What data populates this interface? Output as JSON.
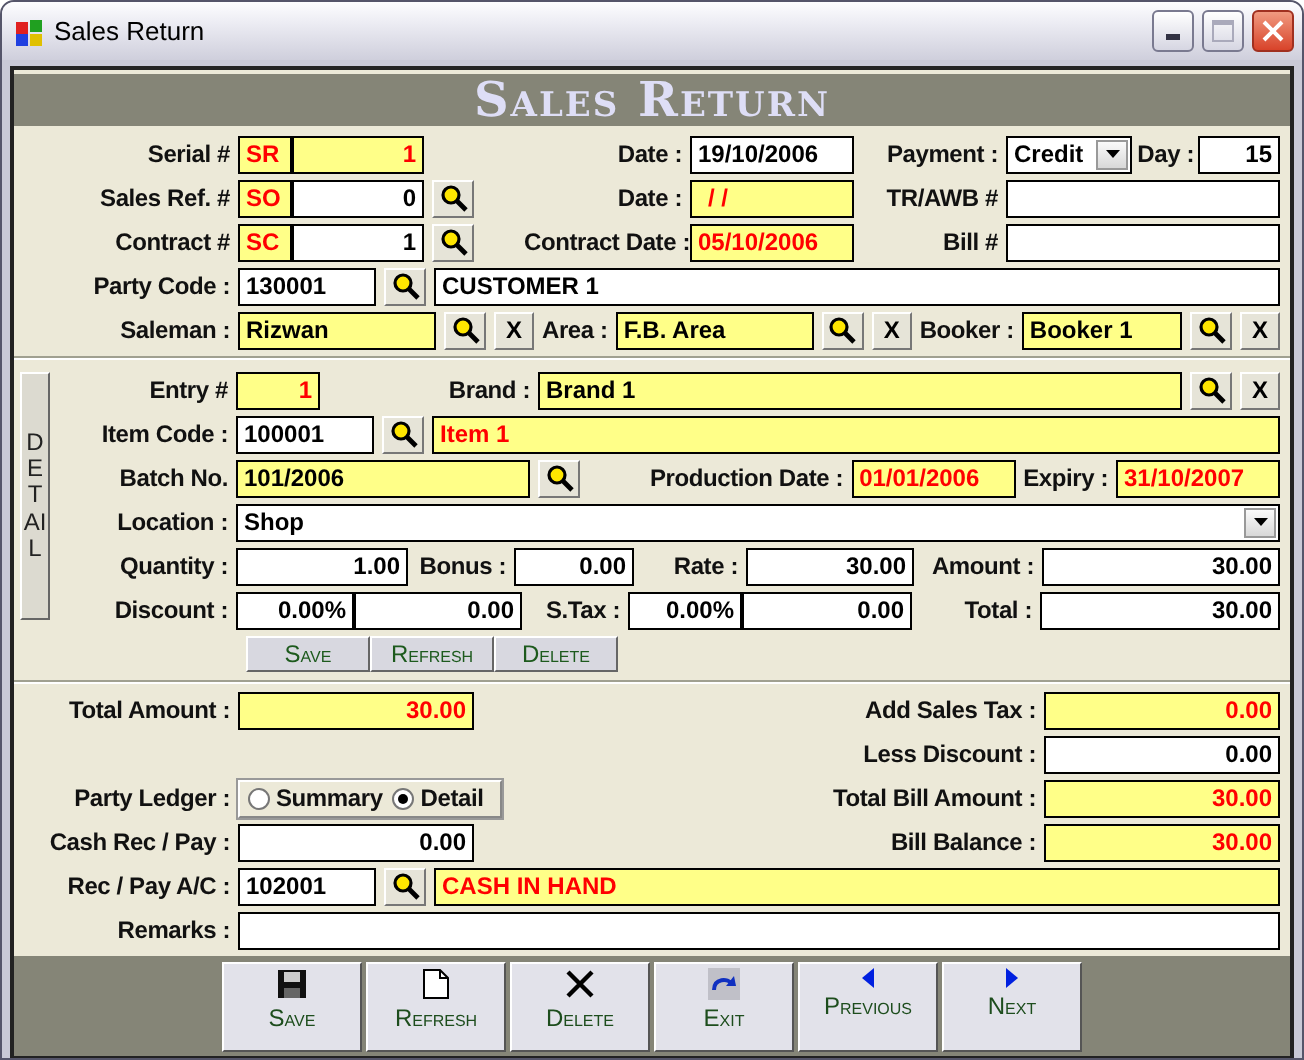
{
  "window": {
    "title": "Sales Return"
  },
  "form_title": "Sales Return",
  "header": {
    "serial": {
      "label": "Serial #",
      "prefix": "SR",
      "value": "1"
    },
    "date": {
      "label": "Date :",
      "value": "19/10/2006"
    },
    "payment": {
      "label": "Payment :",
      "value": "Credit"
    },
    "day": {
      "label": "Day :",
      "value": "15"
    },
    "sales_ref": {
      "label": "Sales Ref. #",
      "prefix": "SO",
      "value": "0"
    },
    "ref_date": {
      "label": "Date :",
      "value": "/ /"
    },
    "tr_awb": {
      "label": "TR/AWB #"
    },
    "contract": {
      "label": "Contract #",
      "prefix": "SC",
      "value": "1"
    },
    "contract_date": {
      "label": "Contract Date :",
      "value": "05/10/2006"
    },
    "bill": {
      "label": "Bill #"
    },
    "party_code": {
      "label": "Party Code :",
      "value": "130001",
      "name": "CUSTOMER 1"
    },
    "saleman": {
      "label": "Saleman :",
      "value": "Rizwan",
      "clear": "X"
    },
    "area": {
      "label": "Area :",
      "value": "F.B. Area",
      "clear": "X"
    },
    "booker": {
      "label": "Booker :",
      "value": "Booker 1",
      "clear": "X"
    }
  },
  "detail": {
    "tab_label": "DETAIL",
    "entry": {
      "label": "Entry #",
      "value": "1"
    },
    "brand": {
      "label": "Brand :",
      "value": "Brand 1",
      "clear": "X"
    },
    "item_code": {
      "label": "Item Code :",
      "value": "100001",
      "name": "Item 1"
    },
    "batch": {
      "label": "Batch No.",
      "value": "101/2006"
    },
    "production_date": {
      "label": "Production Date :",
      "value": "01/01/2006"
    },
    "expiry": {
      "label": "Expiry :",
      "value": "31/10/2007"
    },
    "location": {
      "label": "Location :",
      "value": "Shop"
    },
    "quantity": {
      "label": "Quantity :",
      "value": "1.00"
    },
    "bonus": {
      "label": "Bonus :",
      "value": "0.00"
    },
    "rate": {
      "label": "Rate :",
      "value": "30.00"
    },
    "amount": {
      "label": "Amount :",
      "value": "30.00"
    },
    "discount": {
      "label": "Discount :",
      "percent": "0.00%",
      "value": "0.00"
    },
    "stax": {
      "label": "S.Tax :",
      "percent": "0.00%",
      "value": "0.00"
    },
    "total": {
      "label": "Total :",
      "value": "30.00"
    },
    "buttons": [
      "Save",
      "Refresh",
      "Delete"
    ]
  },
  "summary": {
    "total_amount": {
      "label": "Total Amount :",
      "value": "30.00"
    },
    "add_sales_tax": {
      "label": "Add Sales Tax :",
      "value": "0.00"
    },
    "less_discount": {
      "label": "Less Discount :",
      "value": "0.00"
    },
    "party_ledger": {
      "label": "Party Ledger :",
      "options": [
        {
          "label": "Summary",
          "selected": false
        },
        {
          "label": "Detail",
          "selected": true
        }
      ]
    },
    "total_bill_amount": {
      "label": "Total Bill Amount :",
      "value": "30.00"
    },
    "cash_rec_pay": {
      "label": "Cash Rec / Pay :",
      "value": "0.00"
    },
    "bill_balance": {
      "label": "Bill Balance :",
      "value": "30.00"
    },
    "rec_pay_ac": {
      "label": "Rec / Pay A/C :",
      "value": "102001",
      "name": "CASH IN HAND"
    },
    "remarks": {
      "label": "Remarks :"
    }
  },
  "toolbar": [
    {
      "kind": "save",
      "label": "Save"
    },
    {
      "kind": "refresh",
      "label": "Refresh"
    },
    {
      "kind": "delete",
      "label": "Delete"
    },
    {
      "kind": "exit",
      "label": "Exit"
    },
    {
      "kind": "previous",
      "label": "Previous"
    },
    {
      "kind": "next",
      "label": "Next"
    }
  ]
}
